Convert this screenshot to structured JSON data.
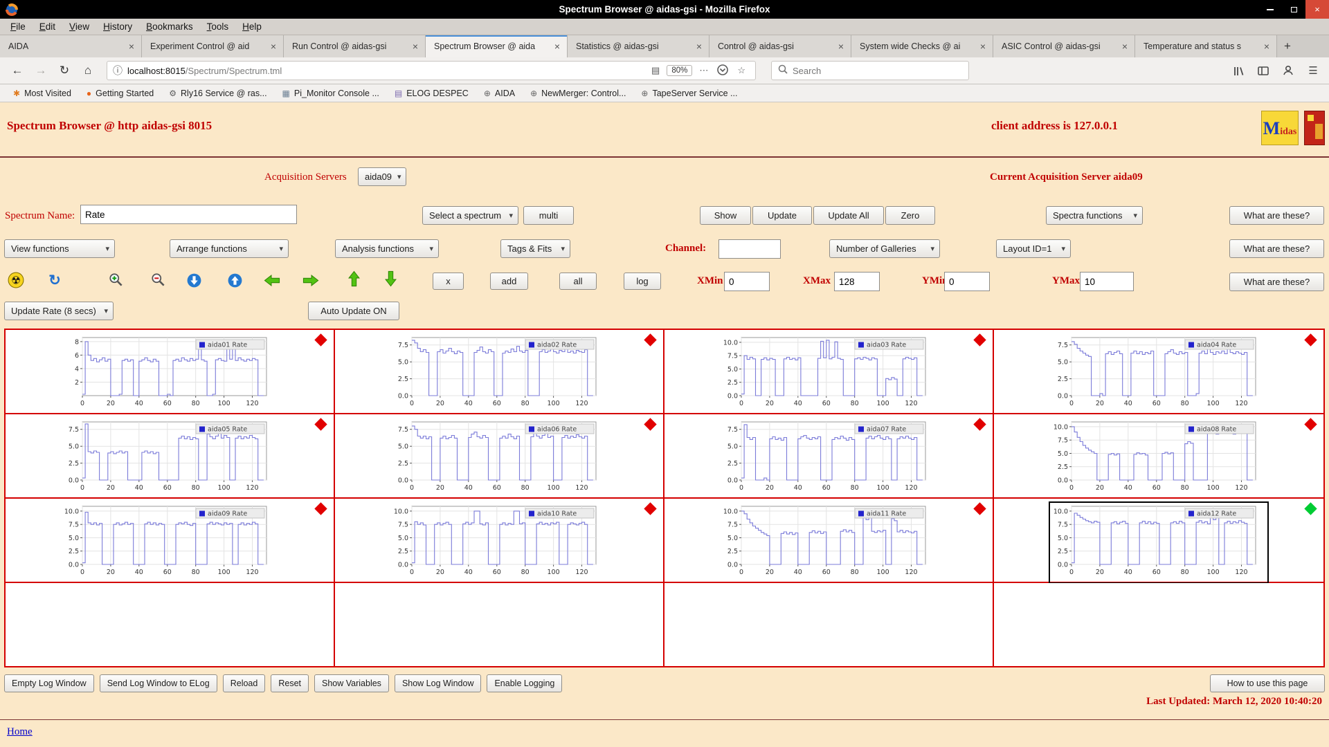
{
  "titlebar": {
    "title": "Spectrum Browser @ aidas-gsi - Mozilla Firefox",
    "close_glyph": "×"
  },
  "menubar": {
    "items": [
      "File",
      "Edit",
      "View",
      "History",
      "Bookmarks",
      "Tools",
      "Help"
    ]
  },
  "tabs": {
    "active_index": 3,
    "new_tab_label": "+",
    "close_glyph": "×",
    "items": [
      {
        "label": "AIDA"
      },
      {
        "label": "Experiment Control @ aid"
      },
      {
        "label": "Run Control @ aidas-gsi"
      },
      {
        "label": "Spectrum Browser @ aida"
      },
      {
        "label": "Statistics @ aidas-gsi"
      },
      {
        "label": "Control @ aidas-gsi"
      },
      {
        "label": "System wide Checks @ ai"
      },
      {
        "label": "ASIC Control @ aidas-gsi"
      },
      {
        "label": "Temperature and status s"
      }
    ]
  },
  "navbar": {
    "url_host": "localhost:8015",
    "url_path": "/Spectrum/Spectrum.tml",
    "zoom": "80%",
    "overflow_glyph": "⋯",
    "search_placeholder": "Search",
    "icons": {
      "back": "←",
      "forward": "→",
      "reload": "↻",
      "home": "⌂",
      "info": "ⓘ",
      "reader": "▤",
      "star": "☆",
      "menu": "☰"
    }
  },
  "ui": {
    "caret": "▾"
  },
  "bookmarks": {
    "items": [
      {
        "label": "Most Visited",
        "icon": "pinwheel-icon",
        "glyph": "✱",
        "color": "#e07b1f"
      },
      {
        "label": "Getting Started",
        "icon": "firefox-icon",
        "glyph": "●",
        "color": "#e8641a"
      },
      {
        "label": "Rly16 Service @ ras...",
        "icon": "gear-icon",
        "glyph": "⚙",
        "color": "#5a5a5a"
      },
      {
        "label": "Pi_Monitor Console ...",
        "icon": "console-icon",
        "glyph": "▦",
        "color": "#6b7f93"
      },
      {
        "label": "ELOG DESPEC",
        "icon": "notebook-icon",
        "glyph": "▤",
        "color": "#7b68ae"
      },
      {
        "label": "AIDA",
        "icon": "globe-icon",
        "glyph": "⊕",
        "color": "#666666"
      },
      {
        "label": "NewMerger: Control...",
        "icon": "globe-icon",
        "glyph": "⊕",
        "color": "#666666"
      },
      {
        "label": "TapeServer Service ...",
        "icon": "globe-icon",
        "glyph": "⊕",
        "color": "#666666"
      }
    ]
  },
  "page": {
    "title": "Spectrum Browser @ http aidas-gsi 8015",
    "client_address": "client address is 127.0.0.1",
    "logo_midas_m": "M",
    "logo_midas_rest": "idas",
    "acquisition_label": "Acquisition Servers",
    "acquisition_select": "aida09",
    "current_server": "Current Acquisition Server aida09",
    "spectrum_name_label": "Spectrum Name:",
    "spectrum_name_value": "Rate",
    "select_spectrum": "Select a spectrum",
    "multi": "multi",
    "show": "Show",
    "update": "Update",
    "update_all": "Update All",
    "zero": "Zero",
    "spectra_functions": "Spectra functions",
    "what_are_these": "What are these?",
    "view_functions": "View functions",
    "arrange_functions": "Arrange functions",
    "analysis_functions": "Analysis functions",
    "tags_fits": "Tags & Fits",
    "channel_label": "Channel:",
    "channel_value": "",
    "number_of_galleries": "Number of Galleries",
    "layout_id": "Layout ID=1",
    "x_btn": "x",
    "add_btn": "add",
    "all_btn": "all",
    "log_btn": "log",
    "xmin_label": "XMin",
    "xmin_value": "0",
    "xmax_label": "XMax",
    "xmax_value": "128",
    "ymin_label": "YMin",
    "ymin_value": "0",
    "ymax_label": "YMax",
    "ymax_value": "10",
    "update_rate": "Update Rate (8 secs)",
    "auto_update": "Auto Update ON",
    "footer_buttons": [
      "Empty Log Window",
      "Send Log Window to ELog",
      "Reload",
      "Reset",
      "Show Variables",
      "Show Log Window",
      "Enable Logging"
    ],
    "help_button": "How to use this page",
    "last_updated": "Last Updated: March 12, 2020 10:40:20",
    "home_link": "Home"
  },
  "chart_data": {
    "type": "line",
    "x_start": 0,
    "x_step": 2,
    "x_max": 130,
    "xticks": [
      0,
      20,
      40,
      60,
      80,
      100,
      120
    ],
    "line_color": "#7b7bd9",
    "charts": [
      {
        "name": "aida01 Rate",
        "ymax": 8.6,
        "yticks": [
          2,
          4,
          6,
          8
        ],
        "ytick_labels": [
          "2",
          "4",
          "6",
          "8"
        ],
        "marker_color": "#e10000",
        "selected": false,
        "values": [
          0.2,
          8,
          6,
          5.2,
          5.5,
          5,
          5.3,
          5.6,
          5.1,
          5.4,
          0,
          0,
          0,
          0.2,
          5.2,
          5.4,
          5.1,
          5.3,
          0,
          0,
          5.1,
          5.3,
          5.6,
          5.2,
          5,
          5.4,
          5.1,
          0,
          0,
          0,
          0.2,
          0,
          5.2,
          5.4,
          5.1,
          5.6,
          5.3,
          5.1,
          5.5,
          5.2,
          5.4,
          7.2,
          5.3,
          5.1,
          0,
          0,
          0.2,
          5.3,
          5.5,
          5.2,
          5.1,
          7.6,
          5.4,
          7.4,
          5.2,
          5.6,
          5.3,
          5.1,
          5.4,
          5.2,
          5.5,
          5.3,
          0,
          0
        ]
      },
      {
        "name": "aida02 Rate",
        "ymax": 8.6,
        "yticks": [
          0,
          2.5,
          5,
          7.5
        ],
        "ytick_labels": [
          "0.0",
          "2.5",
          "5.0",
          "7.5"
        ],
        "marker_color": "#e10000",
        "selected": false,
        "values": [
          8.2,
          7.8,
          7,
          6.5,
          6.8,
          6.4,
          0,
          0,
          0,
          6.5,
          6.8,
          6.3,
          6.6,
          7,
          6.5,
          6.2,
          6.6,
          6.4,
          0,
          0,
          0,
          0,
          6.4,
          6.7,
          7.2,
          6.5,
          6.3,
          6.8,
          6.5,
          0,
          0,
          0,
          6.3,
          6.6,
          6.4,
          6.9,
          6.5,
          7.3,
          6.6,
          6.4,
          6.7,
          0,
          0,
          0,
          0,
          6.5,
          6.8,
          6.4,
          6.6,
          7.1,
          6.5,
          6.3,
          6.7,
          6.5,
          6.9,
          6.4,
          6.6,
          6.3,
          6.7,
          6.5,
          6.4,
          6.8,
          0,
          0
        ]
      },
      {
        "name": "aida03 Rate",
        "ymax": 10.9,
        "yticks": [
          0,
          2.5,
          5,
          7.5,
          10
        ],
        "ytick_labels": [
          "0.0",
          "2.5",
          "5.0",
          "7.5",
          "10.0"
        ],
        "marker_color": "#e10000",
        "selected": false,
        "values": [
          0.3,
          7.5,
          6.8,
          7.2,
          6.9,
          0,
          0,
          6.8,
          7.1,
          6.7,
          7,
          6.8,
          0,
          0,
          0,
          6.9,
          7.2,
          6.8,
          7,
          6.7,
          7.1,
          0,
          0,
          0,
          0,
          0,
          0,
          7,
          10.2,
          7.1,
          10.4,
          6.9,
          7.2,
          10.1,
          7,
          6.8,
          0,
          0,
          0,
          0,
          6.9,
          7.1,
          6.8,
          7.2,
          7,
          6.7,
          7.1,
          6.9,
          0,
          0,
          0,
          3.2,
          3,
          3.4,
          3.1,
          0,
          0,
          6.9,
          7.2,
          7,
          6.8,
          7.1,
          0,
          0
        ]
      },
      {
        "name": "aida04 Rate",
        "ymax": 8.6,
        "yticks": [
          0,
          2.5,
          5,
          7.5
        ],
        "ytick_labels": [
          "0.0",
          "2.5",
          "5.0",
          "7.5"
        ],
        "marker_color": "#e10000",
        "selected": false,
        "values": [
          8,
          7.6,
          7,
          6.6,
          6.3,
          6,
          5.8,
          0,
          0,
          0,
          0.3,
          0,
          6.2,
          6.5,
          6.1,
          6.4,
          6.6,
          6.2,
          0,
          0,
          0,
          6.3,
          6.6,
          6.2,
          6.5,
          6.1,
          6.4,
          6.2,
          6.6,
          0,
          0,
          0,
          0,
          6.2,
          6.5,
          6.8,
          6.3,
          6.1,
          6.5,
          6.2,
          6.4,
          0,
          0,
          0,
          0.3,
          6.3,
          6.6,
          6.2,
          7.2,
          6.4,
          6.1,
          6.5,
          6.3,
          6.6,
          6.2,
          7,
          6.4,
          6.2,
          6.5,
          6.3,
          6.1,
          6.4,
          0,
          0
        ]
      },
      {
        "name": "aida05 Rate",
        "ymax": 8.6,
        "yticks": [
          0,
          2.5,
          5,
          7.5
        ],
        "ytick_labels": [
          "0.0",
          "2.5",
          "5.0",
          "7.5"
        ],
        "marker_color": "#e10000",
        "selected": false,
        "values": [
          0.3,
          8.3,
          4.2,
          4,
          4.3,
          4.1,
          0,
          0,
          0,
          4,
          4.2,
          3.9,
          4.1,
          4.3,
          4,
          4.2,
          0,
          0,
          0,
          0,
          0,
          4.1,
          4.3,
          4,
          4.2,
          3.9,
          4.1,
          0,
          0,
          0,
          0,
          0,
          0,
          0,
          6.2,
          6.5,
          6.1,
          6.4,
          6,
          6.3,
          6.1,
          0,
          0,
          0,
          6.8,
          6.4,
          6.1,
          6.5,
          7.2,
          6.2,
          6.6,
          6.3,
          0,
          0,
          6.2,
          6.5,
          6.1,
          6.4,
          6.2,
          6.6,
          6.3,
          6.1,
          0,
          0
        ]
      },
      {
        "name": "aida06 Rate",
        "ymax": 8.6,
        "yticks": [
          0,
          2.5,
          5,
          7.5
        ],
        "ytick_labels": [
          "0.0",
          "2.5",
          "5.0",
          "7.5"
        ],
        "marker_color": "#e10000",
        "selected": false,
        "values": [
          8,
          7.5,
          6.5,
          6.2,
          6.5,
          6.1,
          6.4,
          0,
          0,
          0,
          6.2,
          6.5,
          6.1,
          6.3,
          6.6,
          6.2,
          0,
          0,
          0,
          0,
          6.3,
          6.8,
          7.1,
          6.4,
          6.2,
          6.6,
          6.3,
          0,
          0,
          0,
          0,
          6.2,
          6.5,
          6.2,
          6.8,
          6.4,
          6.1,
          6.5,
          0,
          0,
          0,
          0,
          6.4,
          7.2,
          6.5,
          6.2,
          6.6,
          7,
          6.3,
          6.5,
          0,
          0,
          0,
          6.3,
          6.6,
          6.2,
          6.5,
          6.3,
          6.7,
          6.4,
          6.2,
          6.5,
          0,
          0
        ]
      },
      {
        "name": "aida07 Rate",
        "ymax": 8.6,
        "yticks": [
          0,
          2.5,
          5,
          7.5
        ],
        "ytick_labels": [
          "0.0",
          "2.5",
          "5.0",
          "7.5"
        ],
        "marker_color": "#e10000",
        "selected": false,
        "values": [
          0.3,
          8.2,
          6.3,
          6,
          6.3,
          0,
          0,
          0,
          0.3,
          0,
          6.1,
          6.4,
          6,
          6.2,
          5.9,
          6.3,
          0,
          0,
          0,
          0,
          6.1,
          6.4,
          6.6,
          6.2,
          6,
          6.3,
          6.1,
          6.4,
          0,
          0,
          0,
          0,
          6,
          6.3,
          6.1,
          6.5,
          6.2,
          5.9,
          6.3,
          6,
          0,
          0,
          0,
          0,
          6.2,
          6.5,
          6.1,
          6.4,
          6.6,
          6.2,
          6,
          6.4,
          6.1,
          0,
          0,
          6.1,
          6.4,
          6.2,
          6.5,
          6.2,
          6,
          6.3,
          0,
          0
        ]
      },
      {
        "name": "aida08 Rate",
        "ymax": 10.9,
        "yticks": [
          0,
          2.5,
          5,
          7.5,
          10
        ],
        "ytick_labels": [
          "0.0",
          "2.5",
          "5.0",
          "7.5",
          "10.0"
        ],
        "marker_color": "#e10000",
        "selected": false,
        "values": [
          10,
          9,
          8,
          7.2,
          6.5,
          6,
          5.6,
          5.3,
          5,
          0,
          0,
          0,
          0,
          4.8,
          5,
          4.7,
          4.9,
          0,
          0,
          0,
          0,
          0,
          4.8,
          5.1,
          4.9,
          5,
          4.7,
          0,
          0,
          0,
          0,
          0,
          5,
          5.2,
          4.9,
          5.1,
          0,
          0,
          0,
          0,
          6.8,
          7.2,
          6.9,
          0,
          0,
          0,
          0,
          0,
          9.2,
          8.8,
          9,
          8.6,
          8.9,
          9.1,
          8.7,
          9,
          8.8,
          8.6,
          8.9,
          8.7,
          9,
          8.8,
          0,
          0
        ]
      },
      {
        "name": "aida09 Rate",
        "ymax": 10.9,
        "yticks": [
          0,
          2.5,
          5,
          7.5,
          10
        ],
        "ytick_labels": [
          "0.0",
          "2.5",
          "5.0",
          "7.5",
          "10.0"
        ],
        "marker_color": "#e10000",
        "selected": false,
        "values": [
          0.3,
          9.8,
          7.8,
          7.5,
          7.8,
          7.4,
          7.7,
          0,
          0,
          0,
          0,
          7.5,
          7.8,
          7.4,
          7.6,
          7.9,
          7.5,
          7.7,
          0,
          0,
          0,
          0,
          7.6,
          7.9,
          7.5,
          7.8,
          7.4,
          7.7,
          7.5,
          0,
          0,
          0,
          0,
          7.5,
          7.8,
          7.6,
          7.9,
          7.5,
          7.3,
          7.7,
          0,
          0,
          0,
          0,
          7.6,
          7.9,
          7.5,
          7.8,
          7.6,
          7.4,
          7.8,
          7.5,
          7.7,
          0,
          0,
          7.5,
          7.8,
          7.4,
          7.7,
          7.5,
          7.9,
          7.6,
          0,
          0
        ]
      },
      {
        "name": "aida10 Rate",
        "ymax": 10.9,
        "yticks": [
          0,
          2.5,
          5,
          7.5,
          10
        ],
        "ytick_labels": [
          "0.0",
          "2.5",
          "5.0",
          "7.5",
          "10.0"
        ],
        "marker_color": "#e10000",
        "selected": false,
        "values": [
          0.3,
          8,
          7.5,
          7.8,
          7.4,
          0,
          0,
          0,
          7.5,
          7.8,
          7.4,
          7.7,
          7.9,
          7.5,
          0,
          0,
          0,
          0,
          7.6,
          7.9,
          7.5,
          7.8,
          10,
          10,
          7.6,
          7.4,
          7.8,
          0,
          0,
          0,
          0,
          7.5,
          7.8,
          7.4,
          7.7,
          7.5,
          10,
          10,
          7.6,
          7.8,
          0,
          0,
          0,
          0,
          7.6,
          7.9,
          7.5,
          7.7,
          7.4,
          7.8,
          7.6,
          7.9,
          0,
          0,
          0,
          7.5,
          7.8,
          7.6,
          7.4,
          7.7,
          7.9,
          7.5,
          0,
          0
        ]
      },
      {
        "name": "aida11 Rate",
        "ymax": 10.9,
        "yticks": [
          0,
          2.5,
          5,
          7.5,
          10
        ],
        "ytick_labels": [
          "0.0",
          "2.5",
          "5.0",
          "7.5",
          "10.0"
        ],
        "marker_color": "#e10000",
        "selected": false,
        "values": [
          10,
          9.5,
          8.5,
          7.8,
          7.2,
          6.8,
          6.4,
          6,
          5.7,
          5.4,
          0,
          0,
          0,
          0,
          5.8,
          6.1,
          5.7,
          6,
          5.6,
          5.9,
          0,
          0,
          0,
          0,
          6,
          6.3,
          5.9,
          6.2,
          5.8,
          6.1,
          0,
          0,
          0,
          0,
          0,
          6.2,
          6.5,
          6.1,
          6.4,
          6,
          0,
          0,
          0,
          8.8,
          8.4,
          8.7,
          6.2,
          6,
          6.3,
          6.1,
          6.4,
          0,
          0,
          8.6,
          8.2,
          6.1,
          6.4,
          6,
          6.3,
          6.1,
          5.9,
          6.2,
          0,
          0
        ]
      },
      {
        "name": "aida12 Rate",
        "ymax": 10.9,
        "yticks": [
          0,
          2.5,
          5,
          7.5,
          10
        ],
        "ytick_labels": [
          "0.0",
          "2.5",
          "5.0",
          "7.5",
          "10.0"
        ],
        "marker_color": "#00cc33",
        "selected": true,
        "values": [
          0.3,
          9.6,
          9.2,
          8.8,
          8.5,
          8.2,
          8,
          7.8,
          8.1,
          7.9,
          0,
          0,
          0,
          0,
          7.8,
          8,
          7.6,
          7.9,
          8.1,
          7.7,
          0,
          0,
          0,
          0,
          7.8,
          8.1,
          7.7,
          8,
          7.6,
          7.9,
          7.7,
          0,
          0,
          0,
          0,
          7.8,
          8,
          7.7,
          8.1,
          7.8,
          0,
          0,
          0,
          0,
          7.9,
          8.2,
          7.8,
          8,
          7.6,
          8.8,
          8.4,
          8.7,
          0,
          0,
          7.8,
          8.1,
          7.7,
          8,
          7.8,
          8.2,
          7.9,
          7.7,
          0,
          0
        ]
      }
    ]
  }
}
